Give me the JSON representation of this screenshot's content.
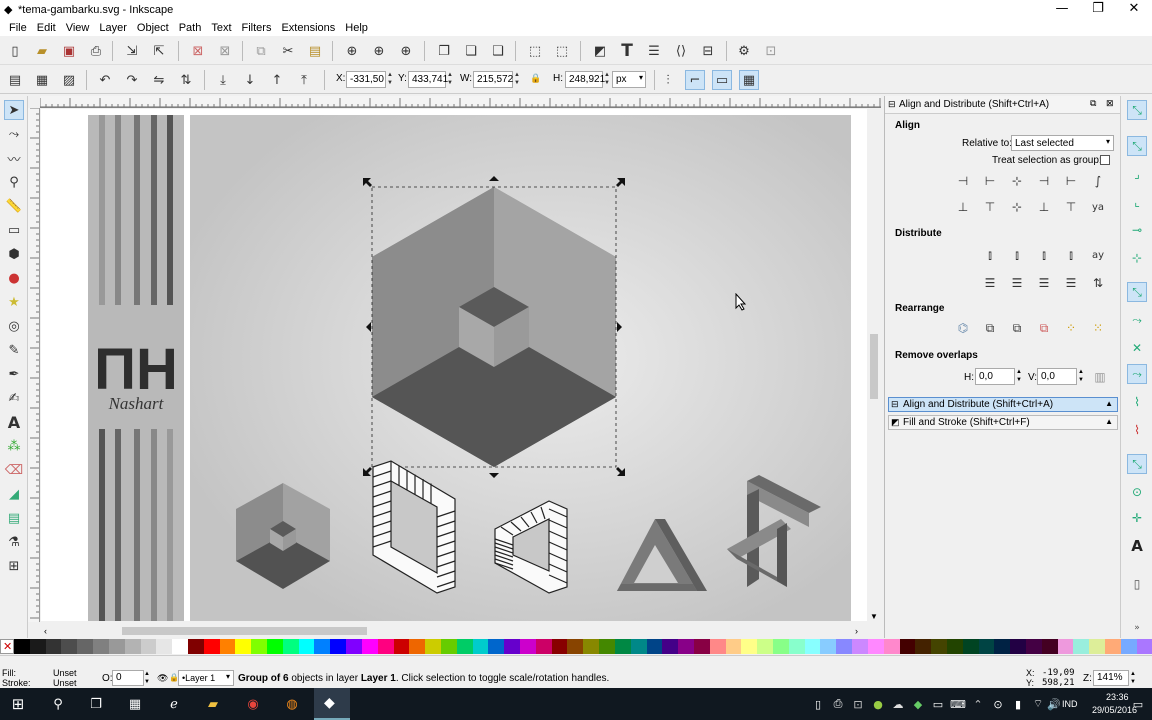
{
  "window": {
    "title": "*tema-gambarku.svg - Inkscape",
    "minimize": "—",
    "maximize": "❐",
    "close": "✕"
  },
  "menu": [
    "File",
    "Edit",
    "View",
    "Layer",
    "Object",
    "Path",
    "Text",
    "Filters",
    "Extensions",
    "Help"
  ],
  "controls": {
    "x_label": "X:",
    "x_value": "-331,50",
    "y_label": "Y:",
    "y_value": "433,741",
    "w_label": "W:",
    "w_value": "215,572",
    "h_label": "H:",
    "h_value": "248,921",
    "lock": "🔒",
    "unit": "px"
  },
  "logo": {
    "mark": "ΠH",
    "name": "Nashart"
  },
  "dock": {
    "title": "Align and Distribute (Shift+Ctrl+A)",
    "align_heading": "Align",
    "relative_label": "Relative to:",
    "relative_value": "Last selected",
    "treat_label": "Treat selection as group:",
    "distribute_heading": "Distribute",
    "rearrange_heading": "Rearrange",
    "overlaps_heading": "Remove overlaps",
    "h_label": "H:",
    "h_value": "0,0",
    "v_label": "V:",
    "v_value": "0,0",
    "panel_align": "Align and Distribute (Shift+Ctrl+A)",
    "panel_fill": "Fill and Stroke (Shift+Ctrl+F)"
  },
  "status": {
    "fill_label": "Fill:",
    "fill_value": "Unset",
    "stroke_label": "Stroke:",
    "stroke_value": "Unset",
    "opacity_label": "O:",
    "opacity_value": "0",
    "layer": "•Layer 1",
    "message_pre": "Group",
    "message_bold1": "of 6",
    "message_mid": "objects in layer",
    "message_bold2": "Layer 1",
    "message_post": ". Click selection to toggle scale/rotation handles.",
    "cursor_x_label": "X:",
    "cursor_x": "-19,09",
    "cursor_y_label": "Y:",
    "cursor_y": "598,21",
    "zoom_label": "Z:",
    "zoom": "141%"
  },
  "taskbar": {
    "time": "23:36",
    "date": "29/05/2016",
    "lang": "IND"
  },
  "colors": {
    "accent": "#3399ff",
    "cube_light": "#a0a0a0",
    "cube_mid": "#8a8a8a",
    "cube_dark": "#505050"
  }
}
